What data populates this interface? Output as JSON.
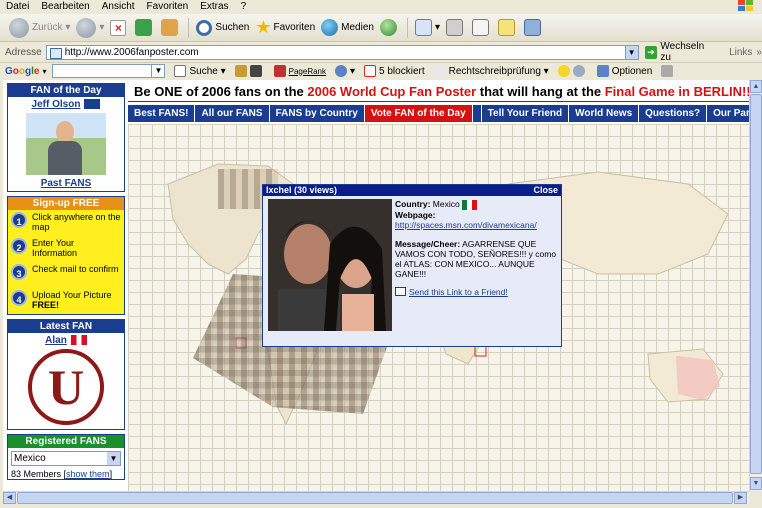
{
  "menu": [
    "Datei",
    "Bearbeiten",
    "Ansicht",
    "Favoriten",
    "Extras",
    "?"
  ],
  "toolbar": {
    "back_label": "Zurück",
    "search_label": "Suchen",
    "favorites_label": "Favoriten",
    "media_label": "Medien"
  },
  "address": {
    "label": "Adresse",
    "url": "http://www.2006fanposter.com",
    "go_label": "Wechseln zu",
    "links_label": "Links"
  },
  "google_bar": {
    "search_label": "Suche",
    "pagerank_label": "PageRank",
    "blocked_label": "5 blockiert",
    "spellcheck_label": "Rechtschreibprüfung",
    "options_label": "Optionen"
  },
  "sidebar": {
    "fan_of_day": {
      "title": "FAN of the Day",
      "name": "Jeff Olson",
      "past_link": "Past FANS"
    },
    "signup": {
      "title": "Sign-up FREE",
      "steps": [
        {
          "num": "1",
          "text": "Click anywhere on the map"
        },
        {
          "num": "2",
          "text": "Enter Your Information"
        },
        {
          "num": "3",
          "text": "Check mail to confirm"
        },
        {
          "num": "4",
          "text": "Upload Your Picture ",
          "bold": "FREE!"
        }
      ]
    },
    "latest": {
      "title": "Latest FAN",
      "name": "Alan",
      "logo_letter": "U"
    },
    "registered": {
      "title": "Registered FANS",
      "country": "Mexico",
      "members": "83 Members [",
      "show_link": "show them",
      "close_bracket": "]"
    }
  },
  "headline": {
    "pre": "Be ONE of 2006 fans on the ",
    "red1": "2006 World Cup Fan Poster",
    "mid": " that will hang at the ",
    "red2": "Final Game in BERLIN!!!"
  },
  "nav": [
    "Best FANS!",
    "All our FANS",
    "FANS by Country",
    "Vote FAN of the Day",
    "Tell Your Friend",
    "World News",
    "Questions?",
    "Our Par"
  ],
  "popup": {
    "title": "Ixchel (30 views)",
    "close": "Close",
    "country_label": "Country:",
    "country": "Mexico",
    "webpage_label": "Webpage:",
    "webpage": "http://spaces.msn.com/divamexicana/",
    "message_label": "Message/Cheer:",
    "message": "AGARRENSE QUE VAMOS CON TODO, SEÑORES!!! y como el ATLAS: CON MEXICO... AUNQUE GANE!!!",
    "send_link": "Send this Link to a Friend!"
  }
}
